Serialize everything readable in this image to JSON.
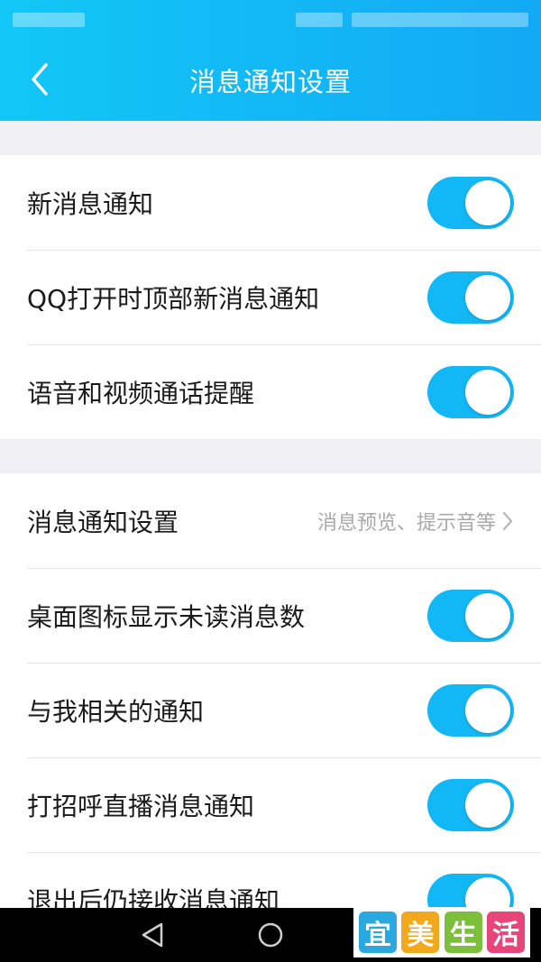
{
  "header": {
    "title": "消息通知设置",
    "back_icon": "chevron-left-icon"
  },
  "group1": {
    "items": [
      {
        "label": "新消息通知",
        "toggle": "on"
      },
      {
        "label": "QQ打开时顶部新消息通知",
        "toggle": "on"
      },
      {
        "label": "语音和视频通话提醒",
        "toggle": "on"
      }
    ]
  },
  "group2": {
    "nav_item": {
      "label": "消息通知设置",
      "hint": "消息预览、提示音等"
    },
    "items": [
      {
        "label": "桌面图标显示未读消息数",
        "toggle": "on"
      },
      {
        "label": "与我相关的通知",
        "toggle": "on"
      },
      {
        "label": "打招呼直播消息通知",
        "toggle": "on"
      },
      {
        "label": "退出后仍接收消息通知",
        "toggle": "on"
      }
    ]
  },
  "colors": {
    "accent": "#12b7f5",
    "header_start": "#12c7f7",
    "header_end": "#12a9f4",
    "background": "#efeff4"
  },
  "watermark": {
    "chars": [
      "宜",
      "美",
      "生",
      "活"
    ],
    "colors": [
      "#2aa9e0",
      "#f2a81d",
      "#7bbf3a",
      "#e8457a"
    ]
  }
}
